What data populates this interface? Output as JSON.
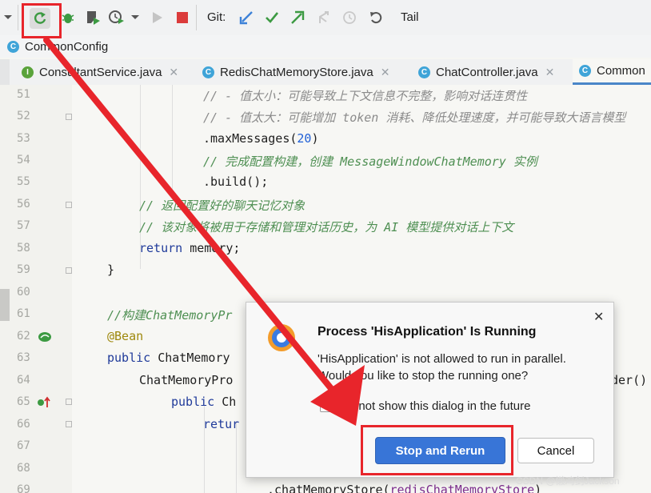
{
  "toolbar": {
    "git_label": "Git:",
    "tail_label": "Tail",
    "icons": [
      "chevron-down-icon",
      "rerun-icon",
      "debug-icon",
      "coverage-icon",
      "profile-icon",
      "chevron-down-icon",
      "play-icon",
      "stop-icon",
      "update-icon",
      "commit-icon",
      "push-icon",
      "merge-icon",
      "history-icon",
      "rollback-icon"
    ]
  },
  "breadcrumb": {
    "label": "CommonConfig",
    "badge": "C"
  },
  "tabs": [
    {
      "label": "ConsultantService.java",
      "badge": "I"
    },
    {
      "label": "RedisChatMemoryStore.java",
      "badge": "C"
    },
    {
      "label": "ChatController.java",
      "badge": "C"
    },
    {
      "label": "Common",
      "badge": "C"
    }
  ],
  "editor": {
    "line_numbers": [
      "51",
      "52",
      "53",
      "54",
      "55",
      "56",
      "57",
      "58",
      "59",
      "60",
      "61",
      "62",
      "63",
      "64",
      "65",
      "66",
      "67",
      "68",
      "69"
    ],
    "lines": {
      "l51": "// - 值太小：可能导致上下文信息不完整，影响对话连贯性",
      "l52": "// - 值太大：可能增加 token 消耗、降低处理速度，并可能导致大语言模型",
      "l53_a": ".maxMessages(",
      "l53_num": "20",
      "l53_b": ")",
      "l54": "// 完成配置构建，创建 MessageWindowChatMemory 实例",
      "l55": ".build();",
      "l56": "// 返回配置好的聊天记忆对象",
      "l57": "// 该对象将被用于存储和管理对话历史，为 AI 模型提供对话上下文",
      "l58_kw": "return",
      "l58_rest": " memory;",
      "l59": "}",
      "l61": "//构建ChatMemoryPr",
      "l62": "@Bean",
      "l63_kw": "public",
      "l63_rest": " ChatMemory",
      "l64": "ChatMemoryPro",
      "l64_right": "der()",
      "l65_kw": "public",
      "l65_rest": " Ch",
      "l66_kw": "retur",
      "l69_a": ".chatMemoryStore(",
      "l69_fld": "redisChatMemoryStore",
      "l69_b": ")"
    }
  },
  "dialog": {
    "title": "Process 'HisApplication' Is Running",
    "message_line1": "'HisApplication' is not allowed to run in parallel.",
    "message_line2": "Would you like to stop the running one?",
    "checkbox_label": "Do not show this dialog in the future",
    "checkbox_checked": false,
    "primary_button": "Stop and Rerun",
    "cancel_button": "Cancel",
    "close_label": "✕"
  },
  "annotations": {
    "highlight_color": "#e8252b",
    "arrow_color": "#e8252b"
  },
  "watermark": "CSDN @懒鸡剑Jackson",
  "colors": {
    "accent": "#3875d7",
    "comment": "#8b8b8b",
    "keyword": "#1f3a9a",
    "number": "#1f5fd6",
    "annotation": "#9e880d"
  }
}
